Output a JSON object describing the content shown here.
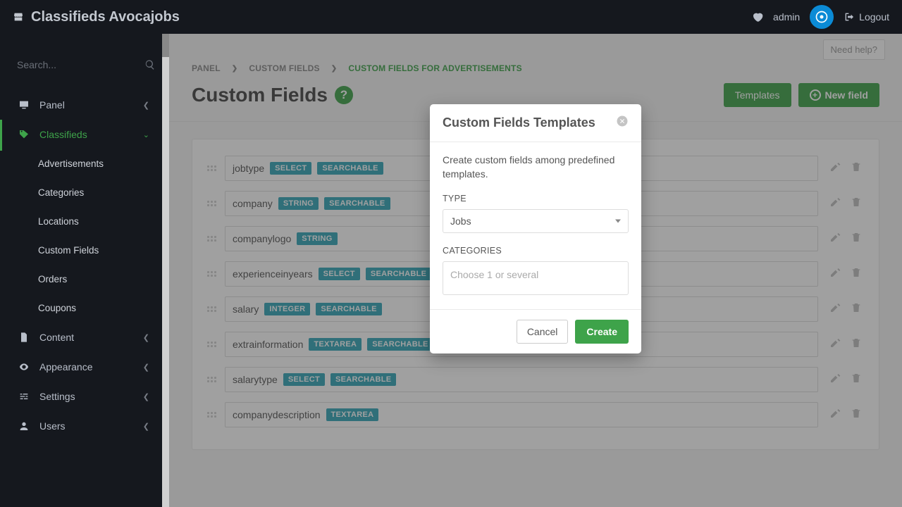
{
  "brand": "Classifieds Avocajobs",
  "topbar": {
    "user": "admin",
    "logout": "Logout"
  },
  "help_link": "Need help?",
  "sidebar": {
    "search_placeholder": "Search...",
    "items": [
      {
        "label": "Panel"
      },
      {
        "label": "Classifieds"
      },
      {
        "label": "Content"
      },
      {
        "label": "Appearance"
      },
      {
        "label": "Settings"
      },
      {
        "label": "Users"
      }
    ],
    "classifieds_children": [
      {
        "label": "Advertisements"
      },
      {
        "label": "Categories"
      },
      {
        "label": "Locations"
      },
      {
        "label": "Custom Fields"
      },
      {
        "label": "Orders"
      },
      {
        "label": "Coupons"
      }
    ]
  },
  "breadcrumbs": {
    "a": "PANEL",
    "b": "CUSTOM FIELDS",
    "c": "CUSTOM FIELDS FOR ADVERTISEMENTS"
  },
  "page_title": "Custom Fields",
  "actions": {
    "templates": "Templates",
    "new_field": "New field"
  },
  "tags": {
    "select": "SELECT",
    "string": "STRING",
    "integer": "INTEGER",
    "textarea": "TEXTAREA",
    "searchable": "SEARCHABLE"
  },
  "fields": [
    {
      "name": "jobtype",
      "type": "select",
      "searchable": true
    },
    {
      "name": "company",
      "type": "string",
      "searchable": true
    },
    {
      "name": "companylogo",
      "type": "string",
      "searchable": false
    },
    {
      "name": "experienceinyears",
      "type": "select",
      "searchable": true
    },
    {
      "name": "salary",
      "type": "integer",
      "searchable": true
    },
    {
      "name": "extrainformation",
      "type": "textarea",
      "searchable": true
    },
    {
      "name": "salarytype",
      "type": "select",
      "searchable": true
    },
    {
      "name": "companydescription",
      "type": "textarea",
      "searchable": false
    }
  ],
  "modal": {
    "title": "Custom Fields Templates",
    "desc": "Create custom fields among predefined templates.",
    "type_label": "TYPE",
    "type_value": "Jobs",
    "categories_label": "CATEGORIES",
    "categories_placeholder": "Choose 1 or several",
    "cancel": "Cancel",
    "create": "Create"
  }
}
